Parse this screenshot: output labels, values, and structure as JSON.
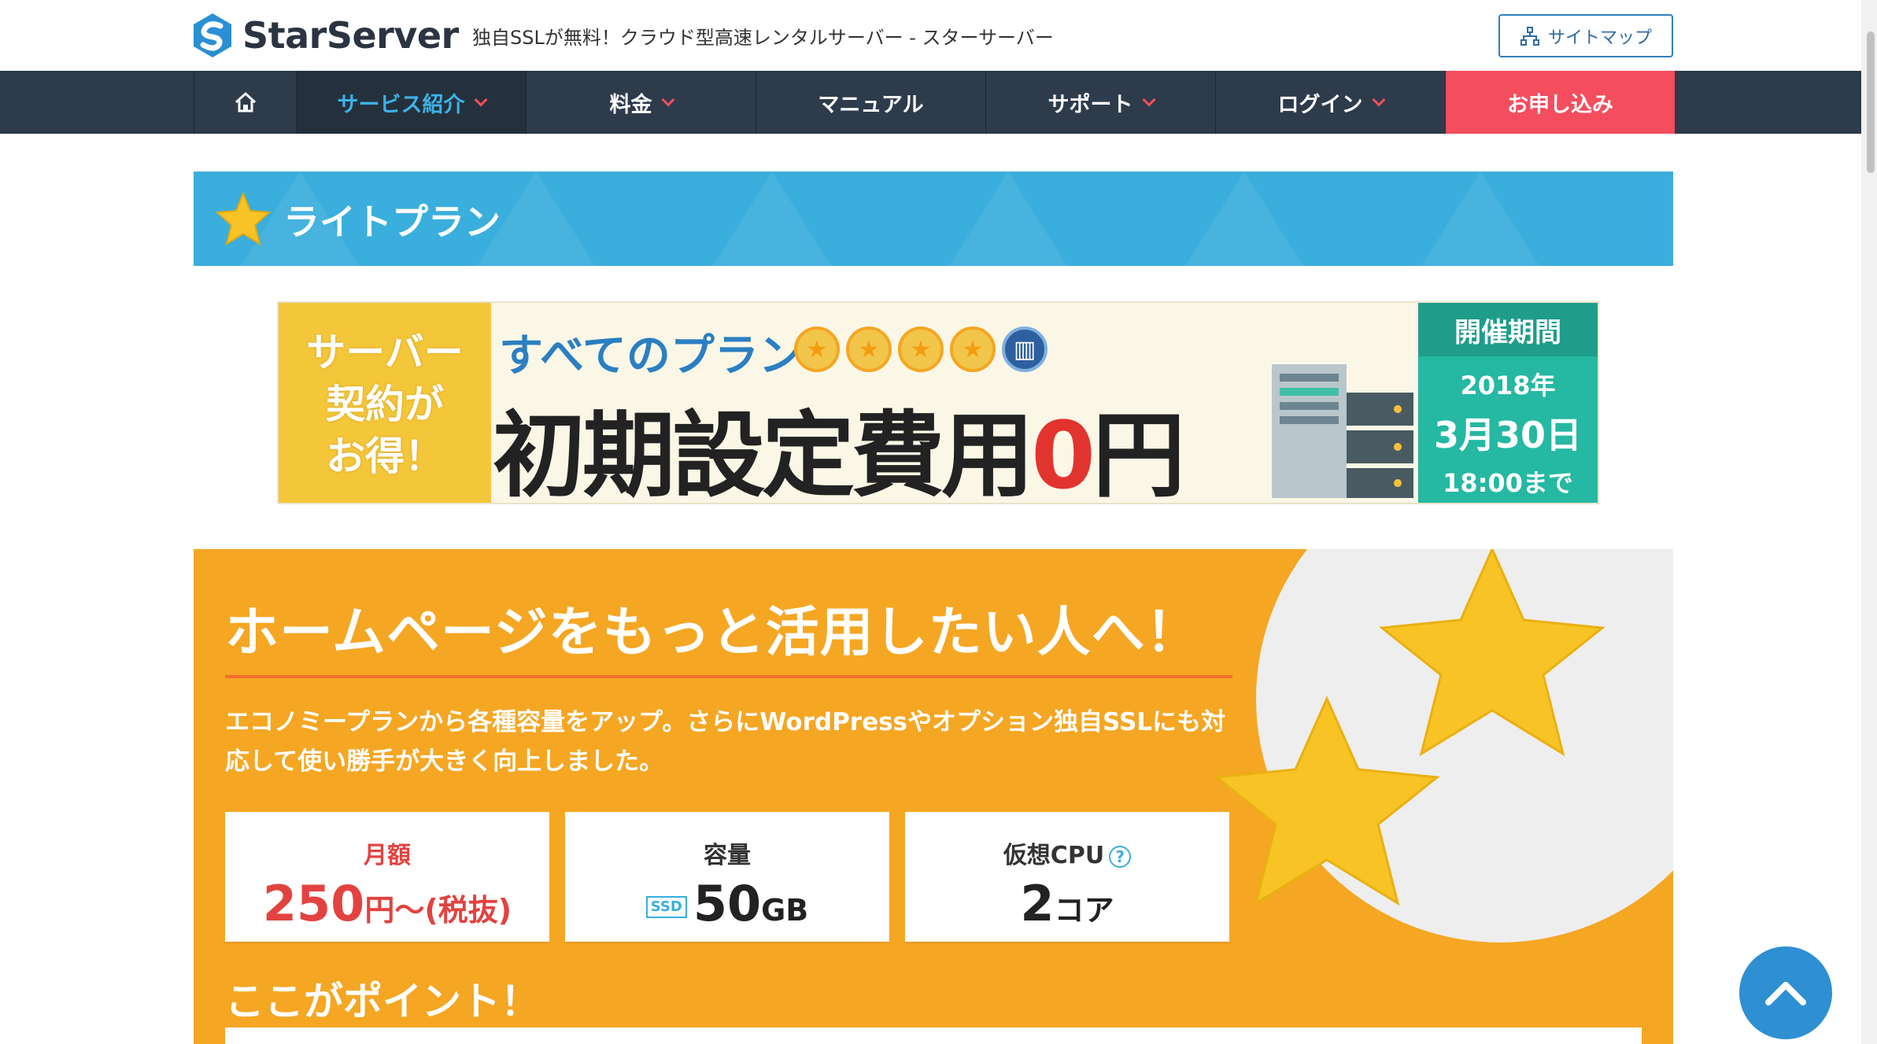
{
  "header": {
    "logo_text": "StarServer",
    "tagline": "独自SSLが無料！クラウド型高速レンタルサーバー - スターサーバー",
    "sitemap_label": "サイトマップ"
  },
  "nav": {
    "items": [
      {
        "label": "サービス紹介"
      },
      {
        "label": "料金"
      },
      {
        "label": "マニュアル"
      },
      {
        "label": "サポート"
      },
      {
        "label": "ログイン"
      },
      {
        "label": "お申し込み"
      }
    ]
  },
  "plan": {
    "title": "ライトプラン"
  },
  "promo": {
    "left_text_1": "サーバー",
    "left_text_2": "契約が",
    "left_text_3": "お得！",
    "sub": "すべてのプラン",
    "main_text": "初期設定費用",
    "main_zero": "0",
    "main_yen": "円",
    "period_title": "開催期間",
    "period_year": "2018年",
    "period_date": "3月30日",
    "period_time": "18:00まで"
  },
  "content": {
    "headline": "ホームページをもっと活用したい人へ！",
    "description": "エコノミープランから各種容量をアップ。さらにWordPressやオプション独自SSLにも対応して使い勝手が大きく向上しました。",
    "specs": [
      {
        "label": "月額",
        "value": "250",
        "unit": "円〜(税抜)"
      },
      {
        "label": "容量",
        "badge": "SSD",
        "value": "50",
        "unit": "GB"
      },
      {
        "label": "仮想CPU",
        "value": "2",
        "unit": "コア"
      }
    ],
    "points_title": "ここがポイント！"
  },
  "colors": {
    "nav_bg": "#2e3b4b",
    "accent_blue": "#3aaedc",
    "apply_red": "#f44d5e",
    "orange": "#f5a623"
  }
}
